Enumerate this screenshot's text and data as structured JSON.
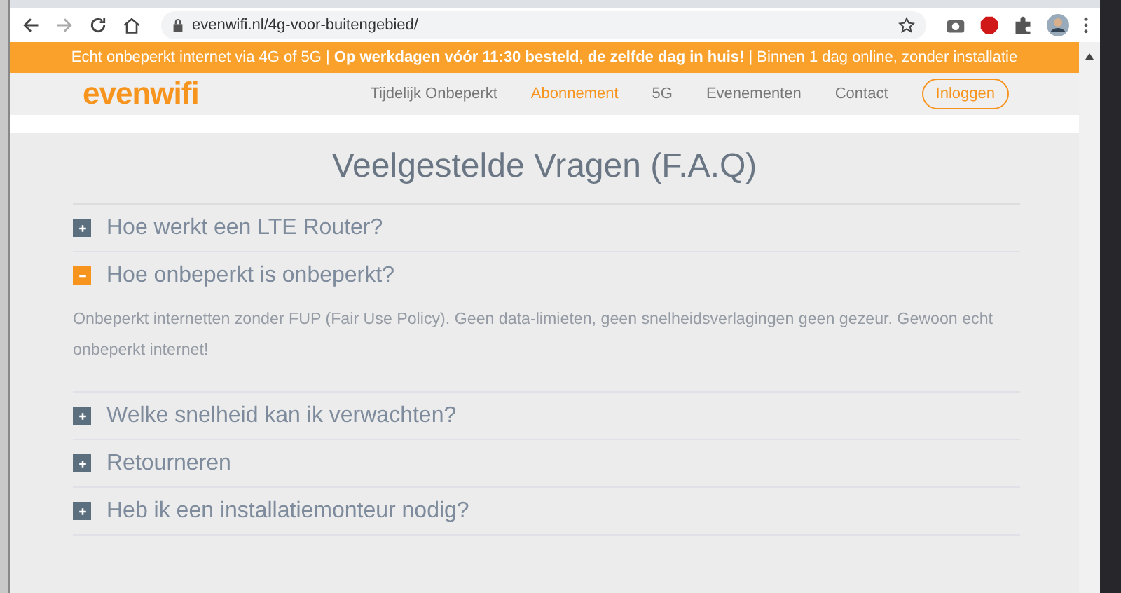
{
  "browser": {
    "url": "evenwifi.nl/4g-voor-buitengebied/"
  },
  "banner": {
    "text": "Echt onbeperkt internet via 4G of 5G | **Op werkdagen vóór 11:30 besteld, de zelfde dag in huis!** | Binnen 1 dag online, zonder installatie"
  },
  "header": {
    "logo": "evenwifi",
    "nav": [
      {
        "label": "Tijdelijk Onbeperkt",
        "selected": false
      },
      {
        "label": "Abonnement",
        "selected": true
      },
      {
        "label": "5G",
        "selected": false
      },
      {
        "label": "Evenementen",
        "selected": false
      },
      {
        "label": "Contact",
        "selected": false
      }
    ],
    "login": "Inloggen"
  },
  "faq": {
    "title": "Veelgestelde Vragen (F.A.Q)",
    "items": [
      {
        "question": "Hoe werkt een LTE Router?",
        "expanded": false
      },
      {
        "question": "Hoe onbeperkt is onbeperkt?",
        "expanded": true,
        "answer": "Onbeperkt internetten zonder FUP (Fair Use Policy). Geen data-limieten, geen snelheidsverlagingen geen gezeur. Gewoon echt onbeperkt internet!"
      },
      {
        "question": "Welke snelheid kan ik verwachten?",
        "expanded": false
      },
      {
        "question": "Retourneren",
        "expanded": false
      },
      {
        "question": "Heb ik een installatiemonteur nodig?",
        "expanded": false
      }
    ]
  }
}
